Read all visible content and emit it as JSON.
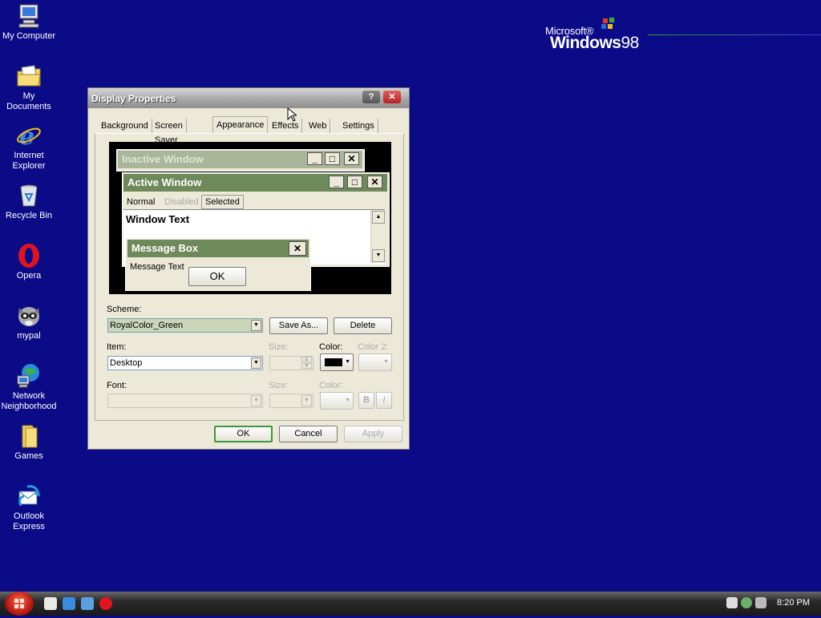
{
  "desktop": {
    "icons": [
      {
        "label": "My Computer",
        "icon": "computer-icon"
      },
      {
        "label": "My Documents",
        "icon": "folder-documents-icon"
      },
      {
        "label": "Internet Explorer",
        "icon": "internet-explorer-icon"
      },
      {
        "label": "Recycle Bin",
        "icon": "recycle-bin-icon"
      },
      {
        "label": "Opera",
        "icon": "opera-icon"
      },
      {
        "label": "mypal",
        "icon": "raccoon-icon"
      },
      {
        "label": "Network Neighborhood",
        "icon": "network-icon"
      },
      {
        "label": "Games",
        "icon": "folder-icon"
      },
      {
        "label": "Outlook Express",
        "icon": "outlook-express-icon"
      }
    ],
    "logo": {
      "company": "Microsoft®",
      "product": "Windows",
      "version": "98"
    }
  },
  "dialog": {
    "title": "Display Properties",
    "help_label": "?",
    "close_label": "✕",
    "tabs": [
      {
        "label": "Background"
      },
      {
        "label": "Screen Saver"
      },
      {
        "label": "Appearance"
      },
      {
        "label": "Effects"
      },
      {
        "label": "Web"
      },
      {
        "label": "Settings"
      }
    ],
    "active_tab": "Appearance",
    "preview": {
      "inactive_title": "Inactive Window",
      "active_title": "Active Window",
      "menu": {
        "normal": "Normal",
        "disabled": "Disabled",
        "selected": "Selected"
      },
      "window_text": "Window Text",
      "message_title": "Message Box",
      "message_text": "Message Text",
      "ok_label": "OK"
    },
    "scheme": {
      "label": "Scheme:",
      "value": "RoyalColor_Green",
      "save_as": "Save As...",
      "delete": "Delete"
    },
    "item": {
      "label": "Item:",
      "value": "Desktop",
      "size_label": "Size:",
      "color_label": "Color:",
      "color2_label": "Color 2:",
      "color_value": "#000000"
    },
    "font": {
      "label": "Font:",
      "size_label": "Size:",
      "color_label": "Color:",
      "bold": "B",
      "italic": "I"
    },
    "buttons": {
      "ok": "OK",
      "cancel": "Cancel",
      "apply": "Apply"
    }
  },
  "taskbar": {
    "clock": "8:20 PM"
  },
  "colors": {
    "desktop": "#0b0b88",
    "caption_active": "#6f8a5a",
    "caption_inactive": "#aab69a"
  }
}
